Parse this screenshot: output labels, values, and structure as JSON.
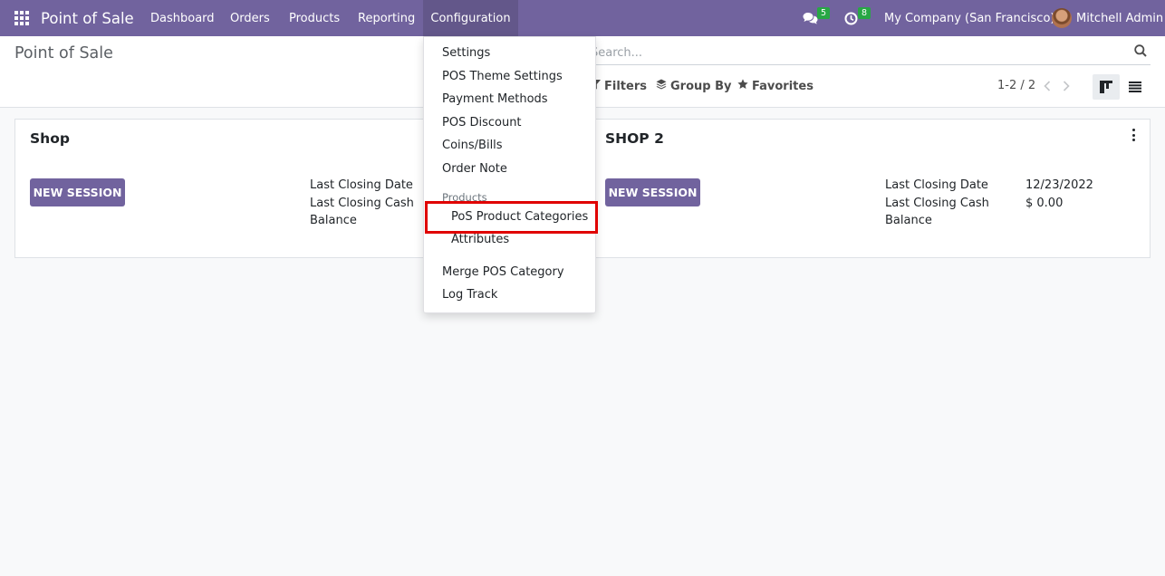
{
  "navbar": {
    "app_name": "Point of Sale",
    "menu": {
      "dashboard": "Dashboard",
      "orders": "Orders",
      "products": "Products",
      "reporting": "Reporting",
      "configuration": "Configuration"
    },
    "messages_count": "5",
    "activities_count": "8",
    "company": "My Company (San Francisco)",
    "user": "Mitchell Admin",
    "accent": "#71639e",
    "badge_color": "#28a745"
  },
  "control_panel": {
    "breadcrumb": "Point of Sale",
    "search_placeholder": "Search...",
    "filters_label": "Filters",
    "group_by_label": "Group By",
    "favorites_label": "Favorites",
    "pager": "1-2 / 2"
  },
  "config_menu": {
    "settings": "Settings",
    "pos_theme_settings": "POS Theme Settings",
    "payment_methods": "Payment Methods",
    "pos_discount": "POS Discount",
    "coins_bills": "Coins/Bills",
    "order_note": "Order Note",
    "products_header": "Products",
    "pos_product_categories": "PoS Product Categories",
    "attributes": "Attributes",
    "merge_pos_category": "Merge POS Category",
    "log_track": "Log Track"
  },
  "cards": [
    {
      "name": "Shop",
      "button": "NEW SESSION",
      "last_closing_date_label": "Last Closing Date",
      "last_closing_cash_label": "Last Closing Cash",
      "balance_label": "Balance",
      "last_closing_date": "",
      "last_closing_cash": ""
    },
    {
      "name": "SHOP 2",
      "button": "NEW SESSION",
      "last_closing_date_label": "Last Closing Date",
      "last_closing_cash_label": "Last Closing Cash",
      "balance_label": "Balance",
      "last_closing_date": "12/23/2022",
      "last_closing_cash": "$ 0.00"
    }
  ],
  "highlight_color": "#e00000"
}
